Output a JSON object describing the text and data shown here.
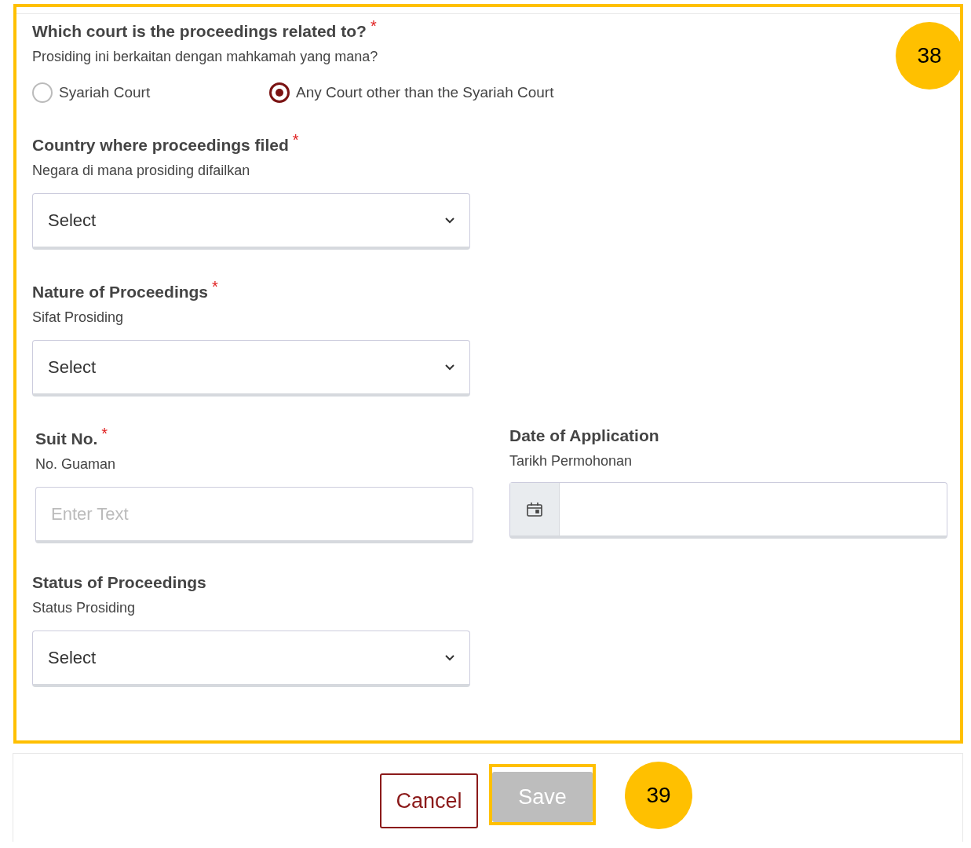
{
  "rows": [
    [
      {
        "kind": "radio",
        "label": "Which court is the proceedings related to?",
        "required_mark": "*",
        "sublabel": "Prosiding ini berkaitan dengan mahkamah yang mana?",
        "options": [
          {
            "label": "Syariah Court",
            "selected": false
          },
          {
            "label": "Any Court other than the Syariah Court",
            "selected": true
          }
        ]
      }
    ],
    [
      {
        "kind": "select",
        "label": "Country where proceedings filed",
        "required_mark": "*",
        "sublabel": "Negara di mana prosiding difailkan",
        "value": "Select"
      }
    ],
    [
      {
        "kind": "select",
        "label": "Nature of Proceedings",
        "required_mark": "*",
        "sublabel": "Sifat Prosiding",
        "value": "Select"
      }
    ],
    [
      {
        "kind": "text",
        "label": "Suit No.",
        "required_mark": "*",
        "sublabel": "No. Guaman",
        "placeholder": "Enter Text"
      },
      {
        "kind": "date",
        "label": "Date of Application",
        "sublabel": "Tarikh Permohonan"
      }
    ],
    [
      {
        "kind": "select",
        "label": "Status of Proceedings",
        "sublabel": "Status Prosiding",
        "value": "Select"
      }
    ]
  ],
  "section_badge": "38",
  "buttons": [
    {
      "kind": "cancel",
      "label": "Cancel",
      "disabled": false,
      "highlighted": false
    },
    {
      "kind": "save",
      "label": "Save",
      "disabled": true,
      "highlighted": true
    }
  ],
  "footer_badge": "39"
}
